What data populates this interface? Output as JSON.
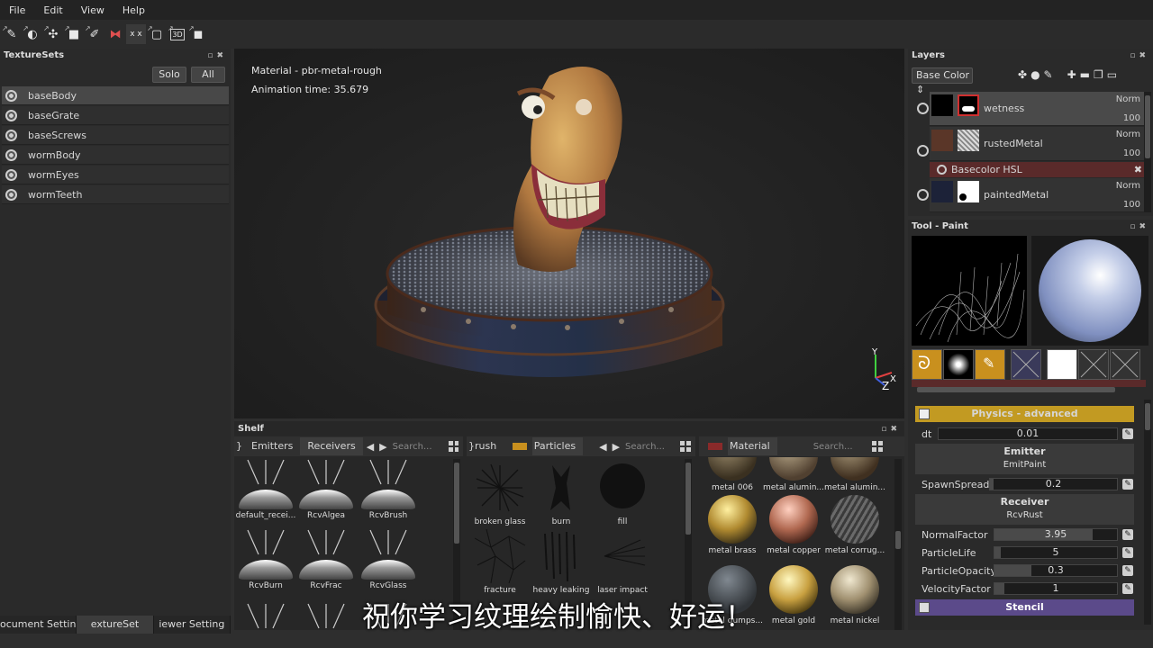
{
  "menu": [
    "File",
    "Edit",
    "View",
    "Help"
  ],
  "texturesets": {
    "title": "TextureSets",
    "solo": "Solo",
    "all": "All",
    "items": [
      "baseBody",
      "baseGrate",
      "baseScrews",
      "wormBody",
      "wormEyes",
      "wormTeeth"
    ]
  },
  "bottom_tabs": [
    "ocument Setting",
    "extureSet",
    "iewer Setting"
  ],
  "viewport": {
    "material": "Material - pbr-metal-rough",
    "animation": "Animation time: 35.679",
    "axis_y": "Y",
    "axis_z": "Z",
    "axis_x": "X"
  },
  "shelf": {
    "title": "Shelf",
    "section1": {
      "tab_prefix": "}",
      "tab_a": "Emitters",
      "tab_b": "Receivers",
      "search": "Search...",
      "items": [
        "default_recei...",
        "RcvAlgea",
        "RcvBrush",
        "RcvBurn",
        "RcvFrac",
        "RcvGlass"
      ]
    },
    "section2": {
      "tab_prefix": "}rush",
      "tab": "Particles",
      "search": "Search...",
      "items": [
        "broken glass",
        "burn",
        "fill",
        "fracture",
        "heavy leaking",
        "laser impact"
      ]
    },
    "section3": {
      "tab": "Material",
      "search": "Search...",
      "row0": [
        "metal 006",
        "metal alumin...",
        "metal alumin..."
      ],
      "row1": [
        "metal brass",
        "metal copper",
        "metal corrug..."
      ],
      "row2": [
        "metal dumps...",
        "metal gold",
        "metal nickel"
      ]
    }
  },
  "layers": {
    "title": "Layers",
    "channel": "Base Color",
    "rows": [
      {
        "name": "wetness",
        "mode": "Norm",
        "value": "100"
      },
      {
        "name": "rustedMetal",
        "mode": "Norm",
        "value": "100"
      },
      {
        "name": "paintedMetal",
        "mode": "Norm",
        "value": "100"
      }
    ],
    "effect": "Basecolor HSL"
  },
  "tool": {
    "title": "Tool - Paint",
    "slots": [
      "brush",
      "alpha",
      "physics",
      "stencil",
      "color",
      "height",
      "rough"
    ],
    "physics_header": "Physics - advanced",
    "dt_label": "dt",
    "dt_value": "0.01",
    "emitter_header": "Emitter",
    "emitter_name": "EmitPaint",
    "spawn_label": "SpawnSpread",
    "spawn_value": "0.2",
    "receiver_header": "Receiver",
    "receiver_name": "RcvRust",
    "normal_label": "NormalFactor",
    "normal_value": "3.95",
    "life_label": "ParticleLife",
    "life_value": "5",
    "opacity_label": "ParticleOpacity",
    "opacity_value": "0.3",
    "velocity_label": "VelocityFactor",
    "velocity_value": "1",
    "stencil_header": "Stencil"
  },
  "subtitle": "祝你学习纹理绘制愉快、好运！",
  "colors": {
    "physics_header": "#c29a22",
    "stencil_header": "#5b4a8a",
    "material_swatch": "#8a2a2a",
    "particles_swatch": "#c9901e"
  }
}
